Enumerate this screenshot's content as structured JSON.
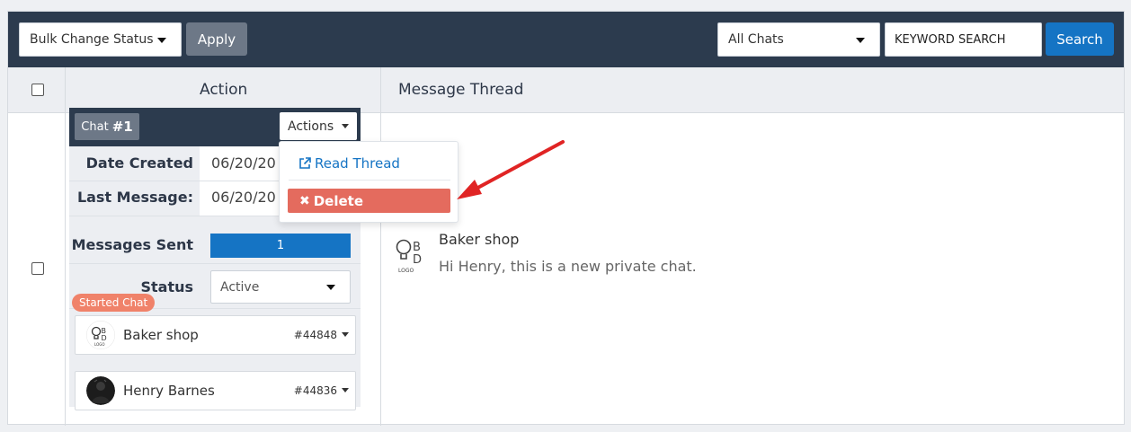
{
  "toolbar": {
    "bulk_select": "Bulk Change Status",
    "apply_label": "Apply",
    "filter_select": "All Chats",
    "search_value": "KEYWORD SEARCH",
    "search_label": "Search"
  },
  "table": {
    "col_action": "Action",
    "col_thread": "Message Thread"
  },
  "chat": {
    "badge_prefix": "Chat",
    "badge_number": "#1",
    "actions_label": "Actions",
    "rows": {
      "date_created_label": "Date Created",
      "date_created_value": "06/20/20",
      "last_message_label": "Last Message:",
      "last_message_value": "06/20/20",
      "messages_sent_label": "Messages Sent",
      "messages_sent_value": "1",
      "status_label": "Status",
      "status_value": "Active"
    },
    "started_tag": "Started Chat",
    "participants": [
      {
        "name": "Baker shop",
        "id": "#44848"
      },
      {
        "name": "Henry Barnes",
        "id": "#44836"
      }
    ]
  },
  "dropdown": {
    "read_thread": "Read Thread",
    "delete": "Delete"
  },
  "thread": {
    "logo_letters": "BD",
    "logo_caption": "LOGO",
    "sender": "Baker shop",
    "message": "Hi Henry, this is a new private chat."
  },
  "colors": {
    "toolbar_bg": "#2c3b4e",
    "primary": "#1574c4",
    "danger": "#e46b5e",
    "tag": "#f0826a",
    "arrow": "#e02424"
  }
}
